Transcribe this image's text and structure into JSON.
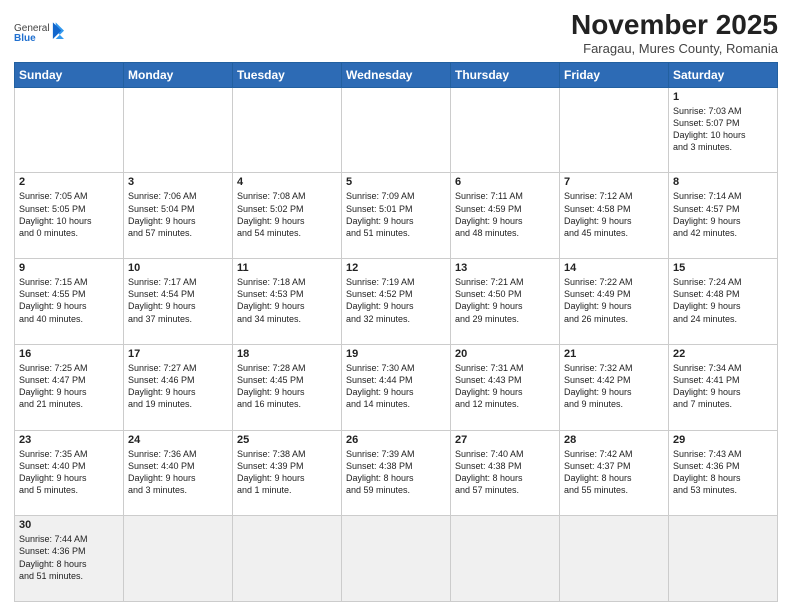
{
  "header": {
    "logo_general": "General",
    "logo_blue": "Blue",
    "month_title": "November 2025",
    "location": "Faragau, Mures County, Romania"
  },
  "weekdays": [
    "Sunday",
    "Monday",
    "Tuesday",
    "Wednesday",
    "Thursday",
    "Friday",
    "Saturday"
  ],
  "weeks": [
    [
      {
        "day": "",
        "info": ""
      },
      {
        "day": "",
        "info": ""
      },
      {
        "day": "",
        "info": ""
      },
      {
        "day": "",
        "info": ""
      },
      {
        "day": "",
        "info": ""
      },
      {
        "day": "",
        "info": ""
      },
      {
        "day": "1",
        "info": "Sunrise: 7:03 AM\nSunset: 5:07 PM\nDaylight: 10 hours\nand 3 minutes."
      }
    ],
    [
      {
        "day": "2",
        "info": "Sunrise: 7:05 AM\nSunset: 5:05 PM\nDaylight: 10 hours\nand 0 minutes."
      },
      {
        "day": "3",
        "info": "Sunrise: 7:06 AM\nSunset: 5:04 PM\nDaylight: 9 hours\nand 57 minutes."
      },
      {
        "day": "4",
        "info": "Sunrise: 7:08 AM\nSunset: 5:02 PM\nDaylight: 9 hours\nand 54 minutes."
      },
      {
        "day": "5",
        "info": "Sunrise: 7:09 AM\nSunset: 5:01 PM\nDaylight: 9 hours\nand 51 minutes."
      },
      {
        "day": "6",
        "info": "Sunrise: 7:11 AM\nSunset: 4:59 PM\nDaylight: 9 hours\nand 48 minutes."
      },
      {
        "day": "7",
        "info": "Sunrise: 7:12 AM\nSunset: 4:58 PM\nDaylight: 9 hours\nand 45 minutes."
      },
      {
        "day": "8",
        "info": "Sunrise: 7:14 AM\nSunset: 4:57 PM\nDaylight: 9 hours\nand 42 minutes."
      }
    ],
    [
      {
        "day": "9",
        "info": "Sunrise: 7:15 AM\nSunset: 4:55 PM\nDaylight: 9 hours\nand 40 minutes."
      },
      {
        "day": "10",
        "info": "Sunrise: 7:17 AM\nSunset: 4:54 PM\nDaylight: 9 hours\nand 37 minutes."
      },
      {
        "day": "11",
        "info": "Sunrise: 7:18 AM\nSunset: 4:53 PM\nDaylight: 9 hours\nand 34 minutes."
      },
      {
        "day": "12",
        "info": "Sunrise: 7:19 AM\nSunset: 4:52 PM\nDaylight: 9 hours\nand 32 minutes."
      },
      {
        "day": "13",
        "info": "Sunrise: 7:21 AM\nSunset: 4:50 PM\nDaylight: 9 hours\nand 29 minutes."
      },
      {
        "day": "14",
        "info": "Sunrise: 7:22 AM\nSunset: 4:49 PM\nDaylight: 9 hours\nand 26 minutes."
      },
      {
        "day": "15",
        "info": "Sunrise: 7:24 AM\nSunset: 4:48 PM\nDaylight: 9 hours\nand 24 minutes."
      }
    ],
    [
      {
        "day": "16",
        "info": "Sunrise: 7:25 AM\nSunset: 4:47 PM\nDaylight: 9 hours\nand 21 minutes."
      },
      {
        "day": "17",
        "info": "Sunrise: 7:27 AM\nSunset: 4:46 PM\nDaylight: 9 hours\nand 19 minutes."
      },
      {
        "day": "18",
        "info": "Sunrise: 7:28 AM\nSunset: 4:45 PM\nDaylight: 9 hours\nand 16 minutes."
      },
      {
        "day": "19",
        "info": "Sunrise: 7:30 AM\nSunset: 4:44 PM\nDaylight: 9 hours\nand 14 minutes."
      },
      {
        "day": "20",
        "info": "Sunrise: 7:31 AM\nSunset: 4:43 PM\nDaylight: 9 hours\nand 12 minutes."
      },
      {
        "day": "21",
        "info": "Sunrise: 7:32 AM\nSunset: 4:42 PM\nDaylight: 9 hours\nand 9 minutes."
      },
      {
        "day": "22",
        "info": "Sunrise: 7:34 AM\nSunset: 4:41 PM\nDaylight: 9 hours\nand 7 minutes."
      }
    ],
    [
      {
        "day": "23",
        "info": "Sunrise: 7:35 AM\nSunset: 4:40 PM\nDaylight: 9 hours\nand 5 minutes."
      },
      {
        "day": "24",
        "info": "Sunrise: 7:36 AM\nSunset: 4:40 PM\nDaylight: 9 hours\nand 3 minutes."
      },
      {
        "day": "25",
        "info": "Sunrise: 7:38 AM\nSunset: 4:39 PM\nDaylight: 9 hours\nand 1 minute."
      },
      {
        "day": "26",
        "info": "Sunrise: 7:39 AM\nSunset: 4:38 PM\nDaylight: 8 hours\nand 59 minutes."
      },
      {
        "day": "27",
        "info": "Sunrise: 7:40 AM\nSunset: 4:38 PM\nDaylight: 8 hours\nand 57 minutes."
      },
      {
        "day": "28",
        "info": "Sunrise: 7:42 AM\nSunset: 4:37 PM\nDaylight: 8 hours\nand 55 minutes."
      },
      {
        "day": "29",
        "info": "Sunrise: 7:43 AM\nSunset: 4:36 PM\nDaylight: 8 hours\nand 53 minutes."
      }
    ],
    [
      {
        "day": "30",
        "info": "Sunrise: 7:44 AM\nSunset: 4:36 PM\nDaylight: 8 hours\nand 51 minutes."
      },
      {
        "day": "",
        "info": ""
      },
      {
        "day": "",
        "info": ""
      },
      {
        "day": "",
        "info": ""
      },
      {
        "day": "",
        "info": ""
      },
      {
        "day": "",
        "info": ""
      },
      {
        "day": "",
        "info": ""
      }
    ]
  ]
}
